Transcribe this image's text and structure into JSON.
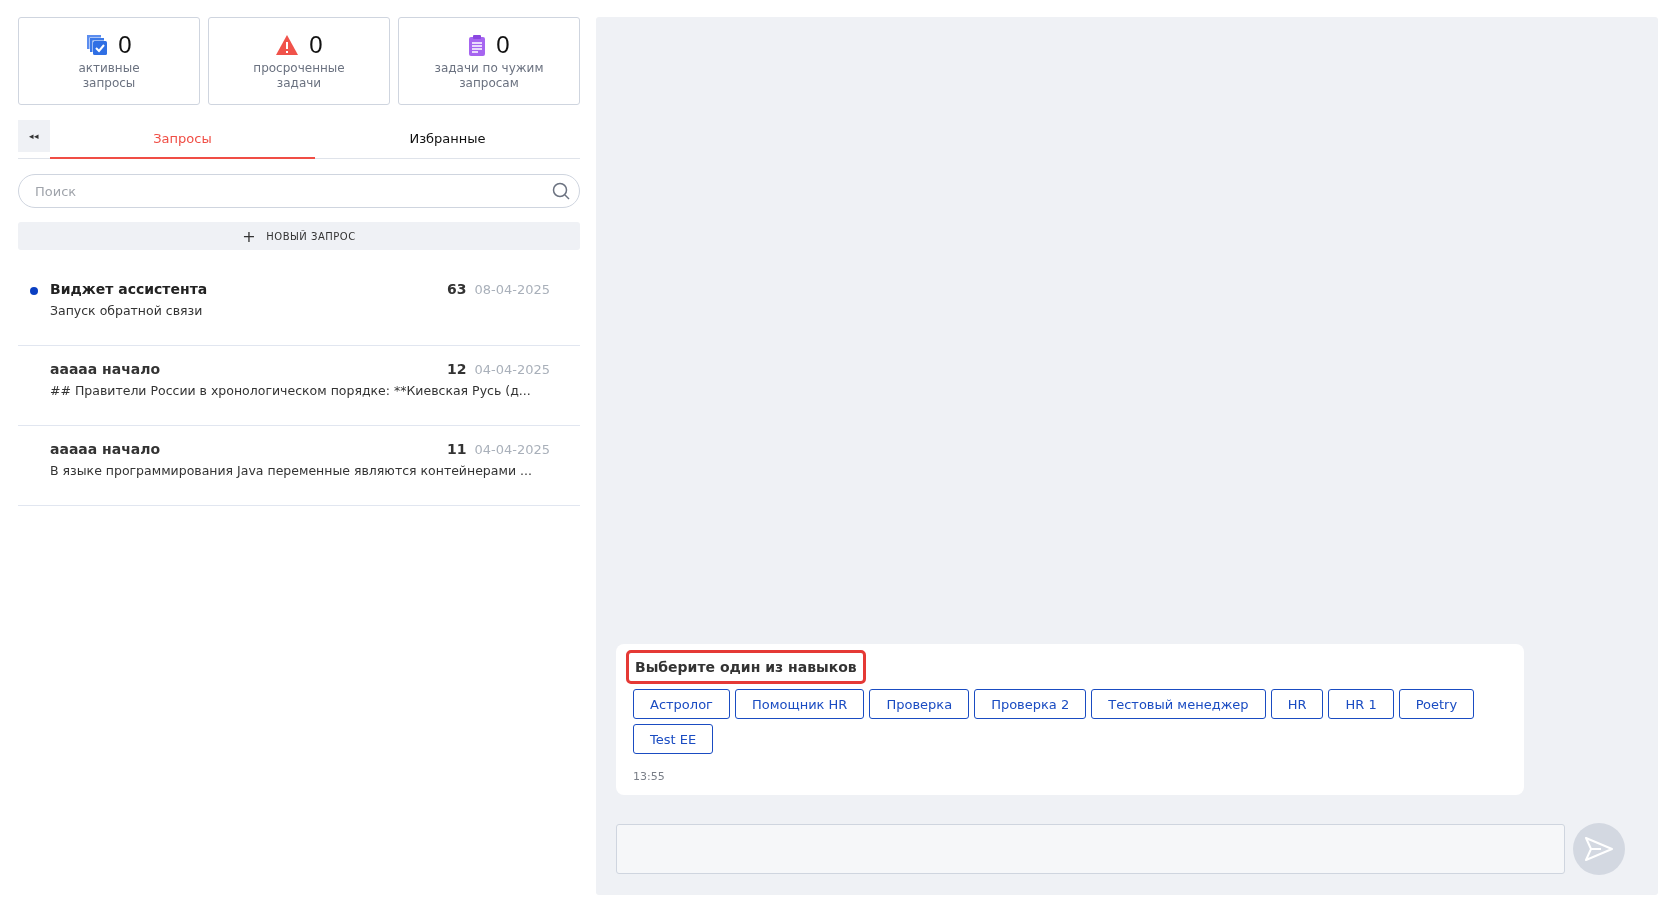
{
  "stats": [
    {
      "kind": "active",
      "value": "0",
      "label": "активные запросы"
    },
    {
      "kind": "overdue",
      "value": "0",
      "label": "просроченные задачи"
    },
    {
      "kind": "foreign",
      "value": "0",
      "label": "задачи по чужим запросам"
    }
  ],
  "collapse_button": "◂◂",
  "tabs": [
    {
      "label": "Запросы",
      "selected": true
    },
    {
      "label": "Избранные",
      "selected": false
    }
  ],
  "search": {
    "placeholder": "Поиск"
  },
  "new_request": {
    "icon": "+",
    "label": "НОВЫЙ ЗАПРОС"
  },
  "requests": [
    {
      "title": "Виджет ассистента",
      "count": "63",
      "date": "08-04-2025",
      "preview": "Запуск обратной связи",
      "unread": true
    },
    {
      "title": "ааааа начало",
      "count": "12",
      "date": "04-04-2025",
      "preview": "## Правители России в хронологическом порядке: **Киевская Русь (д...",
      "unread": false
    },
    {
      "title": "ааааа начало",
      "count": "11",
      "date": "04-04-2025",
      "preview": "В языке программирования Java переменные являются контейнерами ...",
      "unread": false
    }
  ],
  "message": {
    "title": "Выберите один из навыков",
    "skills": [
      "Астролог",
      "Помощник HR",
      "Проверка",
      "Проверка 2",
      "Тестовый менеджер",
      "HR",
      "HR 1",
      "Poetry",
      "Test EE"
    ],
    "time": "13:55"
  }
}
